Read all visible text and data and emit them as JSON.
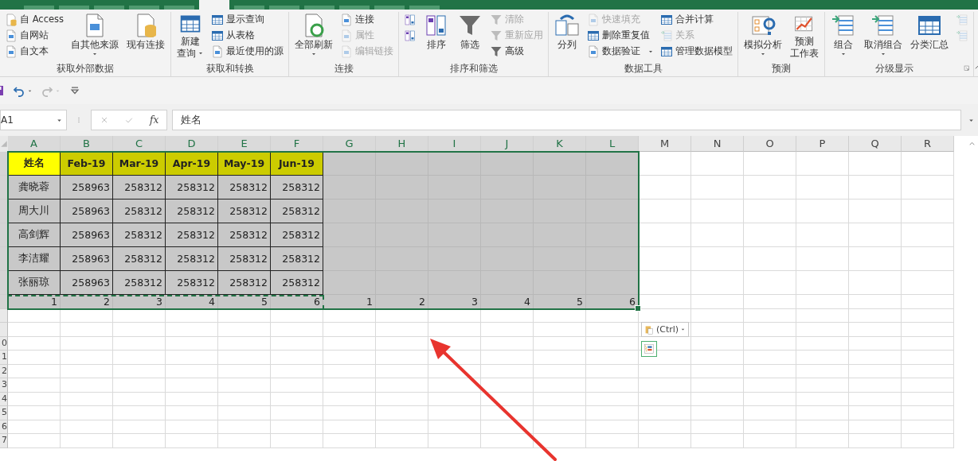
{
  "ribbon_tabs": [
    {
      "selected": false
    },
    {
      "selected": false
    },
    {
      "selected": false
    },
    {
      "selected": false
    },
    {
      "selected": false
    },
    {
      "selected": true
    },
    {
      "selected": false
    },
    {
      "selected": false
    },
    {
      "selected": false
    },
    {
      "selected": false
    },
    {
      "selected": false
    },
    {
      "selected": false
    }
  ],
  "ribbon": {
    "groups": [
      {
        "label": "获取外部数据",
        "columns": [
          {
            "kind": "stack",
            "items": [
              {
                "label": "自 Access",
                "disabled": false
              },
              {
                "label": "自网站",
                "disabled": false
              },
              {
                "label": "自文本",
                "disabled": false
              }
            ]
          },
          {
            "kind": "large",
            "lines": [
              "自其他来源"
            ],
            "dropdown": true
          },
          {
            "kind": "large",
            "lines": [
              "现有连接"
            ]
          }
        ]
      },
      {
        "label": "获取和转换",
        "columns": [
          {
            "kind": "large",
            "lines": [
              "新建",
              "查询"
            ],
            "dropdown": true
          },
          {
            "kind": "stack",
            "items": [
              {
                "label": "显示查询",
                "disabled": false
              },
              {
                "label": "从表格",
                "disabled": false
              },
              {
                "label": "最近使用的源",
                "disabled": false
              }
            ]
          }
        ]
      },
      {
        "label": "连接",
        "columns": [
          {
            "kind": "large",
            "lines": [
              "全部刷新"
            ],
            "dropdown": true
          },
          {
            "kind": "stack",
            "items": [
              {
                "label": "连接",
                "disabled": false
              },
              {
                "label": "属性",
                "disabled": true
              },
              {
                "label": "编辑链接",
                "disabled": true
              }
            ]
          }
        ]
      },
      {
        "label": "排序和筛选",
        "columns": [
          {
            "kind": "stack",
            "items": [
              {
                "disabled": false
              },
              {
                "disabled": false
              }
            ]
          },
          {
            "kind": "large",
            "lines": [
              "排序"
            ]
          },
          {
            "kind": "large",
            "lines": [
              "筛选"
            ]
          },
          {
            "kind": "stack",
            "items": [
              {
                "label": "清除",
                "disabled": true
              },
              {
                "label": "重新应用",
                "disabled": true
              },
              {
                "label": "高级",
                "disabled": false
              }
            ]
          }
        ]
      },
      {
        "label": "数据工具",
        "columns": [
          {
            "kind": "large",
            "lines": [
              "分列"
            ]
          },
          {
            "kind": "stack",
            "items": [
              {
                "label": "快速填充",
                "disabled": true
              },
              {
                "label": "删除重复值",
                "disabled": false
              },
              {
                "label": "数据验证",
                "disabled": false,
                "dropdown": true
              }
            ]
          },
          {
            "kind": "stack",
            "items": [
              {
                "label": "合并计算",
                "disabled": false
              },
              {
                "label": "关系",
                "disabled": true
              },
              {
                "label": "管理数据模型",
                "disabled": false
              }
            ]
          }
        ]
      },
      {
        "label": "预测",
        "columns": [
          {
            "kind": "large",
            "lines": [
              "模拟分析"
            ],
            "dropdown": true
          },
          {
            "kind": "large",
            "lines": [
              "预测",
              "工作表"
            ]
          }
        ]
      },
      {
        "label": "分级显示",
        "launcher": true,
        "columns": [
          {
            "kind": "large",
            "lines": [
              "组合"
            ],
            "dropdown": true
          },
          {
            "kind": "large",
            "lines": [
              "取消组合"
            ],
            "dropdown": true
          },
          {
            "kind": "large",
            "lines": [
              "分类汇总"
            ]
          },
          {
            "kind": "stack",
            "items": [
              {
                "disabled": true
              },
              {
                "disabled": true
              }
            ]
          }
        ]
      }
    ]
  },
  "quick_access": [
    {
      "kind": "save"
    },
    {
      "kind": "undo",
      "disabled": false
    },
    {
      "kind": "redo",
      "disabled": true
    },
    {
      "kind": "customize"
    }
  ],
  "formula_bar": {
    "name_box": "A1",
    "fx_label": "fx",
    "formula": "姓名"
  },
  "sheet": {
    "columns": [
      {
        "label": "A",
        "selected": true
      },
      {
        "label": "B",
        "selected": true
      },
      {
        "label": "C",
        "selected": true
      },
      {
        "label": "D",
        "selected": true
      },
      {
        "label": "E",
        "selected": true
      },
      {
        "label": "F",
        "selected": true
      },
      {
        "label": "G",
        "selected": true
      },
      {
        "label": "H",
        "selected": true
      },
      {
        "label": "I",
        "selected": true
      },
      {
        "label": "J",
        "selected": true
      },
      {
        "label": "K",
        "selected": true
      },
      {
        "label": "L",
        "selected": true
      },
      {
        "label": "M",
        "selected": false
      },
      {
        "label": "N",
        "selected": false
      },
      {
        "label": "O",
        "selected": false
      },
      {
        "label": "P",
        "selected": false
      },
      {
        "label": "Q",
        "selected": false
      },
      {
        "label": "R",
        "selected": false
      }
    ],
    "rows": [
      {
        "kind": "header",
        "selected": true,
        "cells": [
          {
            "text": "姓名",
            "color": "#ffff00"
          },
          {
            "text": "Feb-19",
            "color": "#cccc00"
          },
          {
            "text": "Mar-19",
            "color": "#cccc00"
          },
          {
            "text": "Apr-19",
            "color": "#cccc00"
          },
          {
            "text": "May-19",
            "color": "#cccc00"
          },
          {
            "text": "Jun-19",
            "color": "#cccc00"
          }
        ]
      },
      {
        "kind": "data",
        "selected": true,
        "cells": [
          {
            "text": "龚晓蓉"
          },
          {
            "text": "258963"
          },
          {
            "text": "258312"
          },
          {
            "text": "258312"
          },
          {
            "text": "258312"
          },
          {
            "text": "258312"
          }
        ]
      },
      {
        "kind": "data",
        "selected": true,
        "cells": [
          {
            "text": "周大川"
          },
          {
            "text": "258963"
          },
          {
            "text": "258312"
          },
          {
            "text": "258312"
          },
          {
            "text": "258312"
          },
          {
            "text": "258312"
          }
        ]
      },
      {
        "kind": "data",
        "selected": true,
        "cells": [
          {
            "text": "高剑辉"
          },
          {
            "text": "258963"
          },
          {
            "text": "258312"
          },
          {
            "text": "258312"
          },
          {
            "text": "258312"
          },
          {
            "text": "258312"
          }
        ]
      },
      {
        "kind": "data",
        "selected": true,
        "cells": [
          {
            "text": "李洁耀"
          },
          {
            "text": "258963"
          },
          {
            "text": "258312"
          },
          {
            "text": "258312"
          },
          {
            "text": "258312"
          },
          {
            "text": "258312"
          }
        ]
      },
      {
        "kind": "data",
        "selected": true,
        "cells": [
          {
            "text": "张丽琼"
          },
          {
            "text": "258963"
          },
          {
            "text": "258312"
          },
          {
            "text": "258312"
          },
          {
            "text": "258312"
          },
          {
            "text": "258312"
          }
        ]
      },
      {
        "kind": "numbers",
        "selected": true,
        "cells": [
          {
            "text": "1",
            "copied": true
          },
          {
            "text": "2",
            "copied": true
          },
          {
            "text": "3",
            "copied": true
          },
          {
            "text": "4",
            "copied": true
          },
          {
            "text": "5",
            "copied": true
          },
          {
            "text": "6",
            "copied": true
          },
          {
            "text": "1",
            "copied": false
          },
          {
            "text": "2",
            "copied": false
          },
          {
            "text": "3",
            "copied": false
          },
          {
            "text": "4",
            "copied": false
          },
          {
            "text": "5",
            "copied": false
          },
          {
            "text": "6",
            "copied": false
          }
        ]
      },
      {
        "selected": false
      },
      {
        "selected": false
      },
      {
        "selected": false,
        "header": "0"
      },
      {
        "selected": false,
        "header": "1"
      },
      {
        "selected": false,
        "header": "2"
      },
      {
        "selected": false,
        "header": "3"
      },
      {
        "selected": false,
        "header": "4"
      },
      {
        "selected": false,
        "header": "5"
      },
      {
        "selected": false,
        "header": "6"
      },
      {
        "selected": false,
        "header": "7"
      }
    ]
  },
  "paste_options": {
    "label": "(Ctrl)"
  },
  "annotations": [
    {
      "kind": "arrow"
    }
  ]
}
